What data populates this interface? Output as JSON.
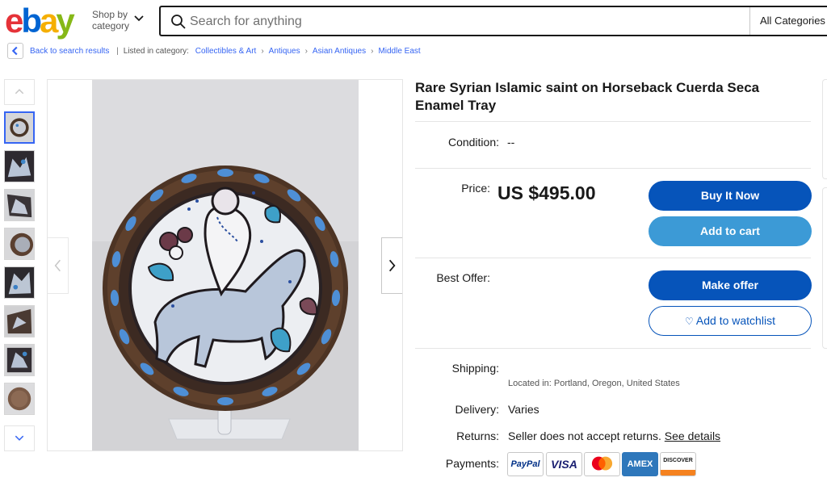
{
  "header": {
    "logo": {
      "letters": [
        "e",
        "b",
        "a",
        "y"
      ],
      "colors": [
        "#e53238",
        "#0064d2",
        "#f5af02",
        "#86b817"
      ]
    },
    "shop_by": "Shop by category",
    "search_placeholder": "Search for anything",
    "category_select": "All Categories"
  },
  "breadcrumb": {
    "back_label": "Back to search results",
    "listed_in": "Listed in category:",
    "items": [
      "Collectibles & Art",
      "Antiques",
      "Asian Antiques",
      "Middle East"
    ]
  },
  "gallery": {
    "thumbnail_count": 8,
    "active_index": 0
  },
  "product": {
    "title": "Rare Syrian Islamic saint on Horseback Cuerda Seca Enamel Tray",
    "condition_label": "Condition:",
    "condition_value": "--",
    "price_label": "Price:",
    "price": "US $495.00",
    "buy_now": "Buy It Now",
    "add_to_cart": "Add to cart",
    "best_offer_label": "Best Offer:",
    "make_offer": "Make offer",
    "watchlist": "Add to watchlist",
    "shipping_label": "Shipping:",
    "location": "Located in: Portland, Oregon, United States",
    "delivery_label": "Delivery:",
    "delivery_value": "Varies",
    "returns_label": "Returns:",
    "returns_value": "Seller does not accept returns.",
    "returns_link": "See details",
    "payments_label": "Payments:",
    "payments": [
      "PayPal",
      "VISA",
      "mastercard",
      "AMEX",
      "DISCOVER"
    ]
  },
  "colors": {
    "accent": "#3665f3",
    "button_primary": "#0654ba",
    "button_secondary": "#3c9ad6"
  }
}
